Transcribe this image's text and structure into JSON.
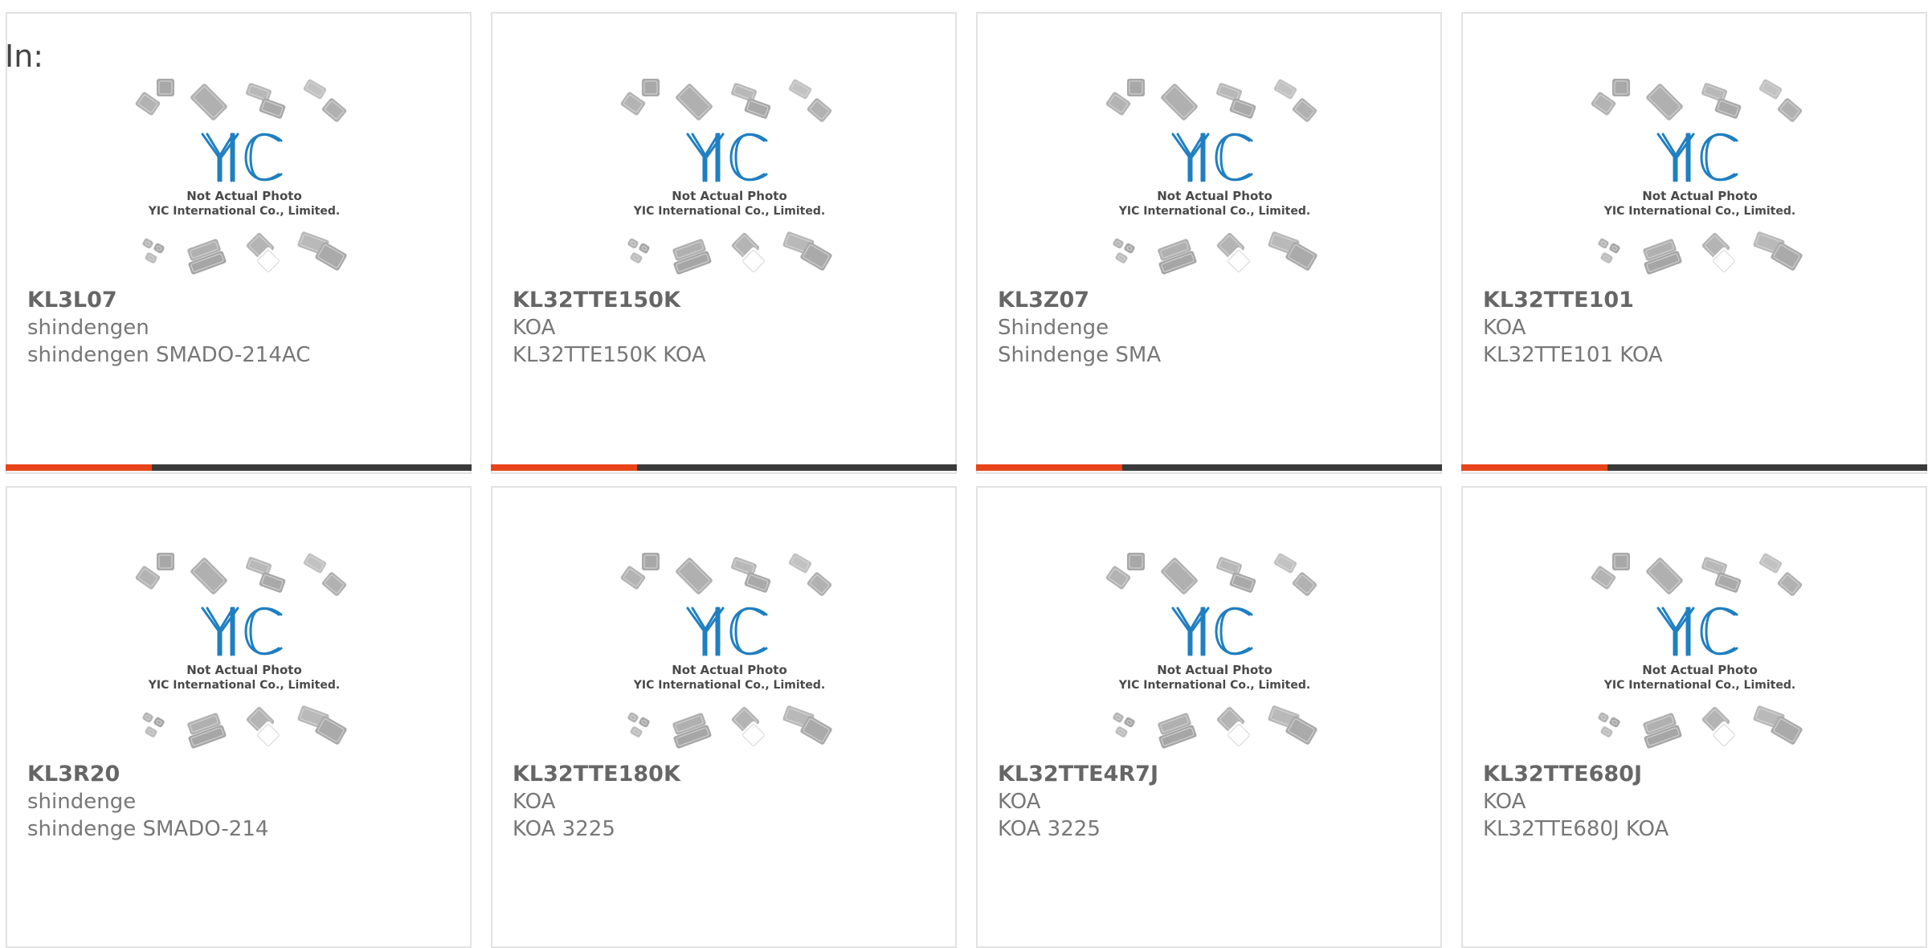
{
  "page": {
    "label": "In:"
  },
  "accent_color": "#e8441a",
  "bar_color": "#3a3a3a",
  "placeholder": {
    "icon": "yic-logo-icon",
    "line1": "Not Actual Photo",
    "line2": "YIC International Co., Limited."
  },
  "products": [
    {
      "part_number": "KL3L07",
      "manufacturer": "shindengen",
      "description": "shindengen SMADO-214AC"
    },
    {
      "part_number": "KL32TTE150K",
      "manufacturer": "KOA",
      "description": "KL32TTE150K KOA"
    },
    {
      "part_number": "KL3Z07",
      "manufacturer": "Shindenge",
      "description": "Shindenge SMA"
    },
    {
      "part_number": "KL32TTE101",
      "manufacturer": "KOA",
      "description": "KL32TTE101 KOA"
    },
    {
      "part_number": "KL3R20",
      "manufacturer": "shindenge",
      "description": "shindenge SMADO-214"
    },
    {
      "part_number": "KL32TTE180K",
      "manufacturer": "KOA",
      "description": "KOA 3225"
    },
    {
      "part_number": "KL32TTE4R7J",
      "manufacturer": "KOA",
      "description": "KOA 3225"
    },
    {
      "part_number": "KL32TTE680J",
      "manufacturer": "KOA",
      "description": "KL32TTE680J KOA"
    }
  ]
}
